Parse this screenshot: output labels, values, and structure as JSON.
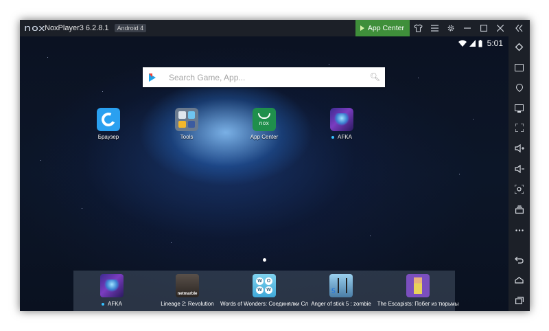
{
  "window": {
    "logo_text": "nox",
    "title": "NoxPlayer3 6.2.8.1",
    "android_badge": "Android 4",
    "app_center_label": "App Center"
  },
  "titlebar_icons": [
    "shirt-icon",
    "menu-icon",
    "gear-icon",
    "minimize-icon",
    "maximize-icon",
    "close-icon",
    "collapse-sidebar-icon"
  ],
  "status": {
    "time": "5:01",
    "icons": [
      "wifi-icon",
      "signal-icon",
      "battery-icon"
    ]
  },
  "search": {
    "placeholder": "Search Game, App..."
  },
  "home_apps": [
    {
      "label": "Браузер",
      "icon": "browser-icon"
    },
    {
      "label": "Tools",
      "icon": "tools-folder-icon"
    },
    {
      "label": "App Center",
      "icon": "app-center-icon",
      "sublabel": "nox"
    },
    {
      "label": "AFKA",
      "icon": "afka-icon",
      "new_dot": true
    }
  ],
  "dock_apps": [
    {
      "label": "AFKA",
      "icon": "afka-icon",
      "new_dot": true
    },
    {
      "label": "Lineage 2: Revolution",
      "icon": "lineage2-icon",
      "badge": "netmarble"
    },
    {
      "label": "Words of Wonders: Соединялки Сл",
      "icon": "words-of-wonders-icon",
      "letters": [
        "W",
        "O",
        "W",
        "W"
      ]
    },
    {
      "label": "Anger of stick 5 : zombie",
      "icon": "anger-of-stick-icon",
      "num": "5"
    },
    {
      "label": "The Escapists: Побег из тюрьмы",
      "icon": "escapists-icon"
    }
  ],
  "sidebar_tools": [
    "rotate-icon",
    "screenshot-tool-icon",
    "location-icon",
    "screen-icon",
    "fullscreen-icon",
    "volume-up-icon",
    "volume-down-icon",
    "capture-icon",
    "multi-instance-icon",
    "more-icon",
    "back-icon",
    "home-icon",
    "recent-apps-icon"
  ],
  "colors": {
    "titlebar": "#1c2028",
    "app_center_green": "#3f8f3a",
    "accent_blue": "#36c0ff"
  }
}
